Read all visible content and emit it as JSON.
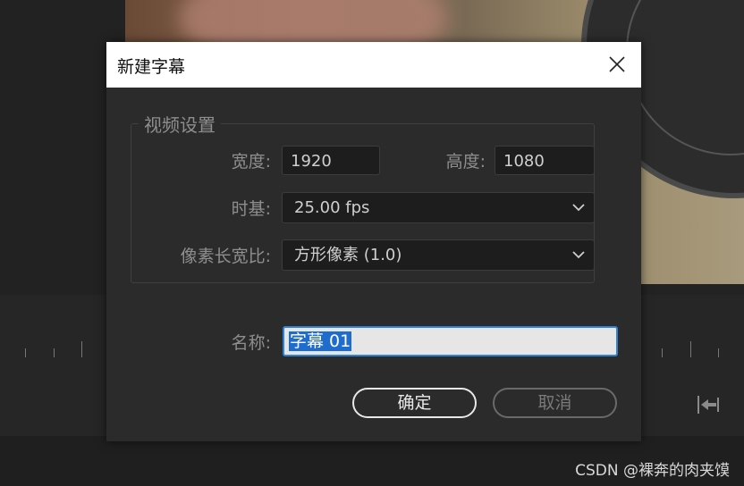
{
  "dialog": {
    "title": "新建字幕",
    "video_settings": {
      "legend": "视频设置",
      "width_label": "宽度:",
      "width_value": "1920",
      "height_label": "高度:",
      "height_value": "1080",
      "timebase_label": "时基:",
      "timebase_value": "25.00 fps",
      "aspect_label": "像素长宽比:",
      "aspect_value": "方形像素 (1.0)"
    },
    "name_label": "名称:",
    "name_value": "字幕 01",
    "ok_label": "确定",
    "cancel_label": "取消"
  },
  "watermark": "CSDN @裸奔的肉夹馍",
  "icons": [
    "close-icon",
    "chevron-down-icon",
    "go-to-out-point-icon"
  ],
  "colors": {
    "accent": "#2f82d6",
    "selection": "#1f6ccf",
    "dialog_bg": "#2b2b2b"
  }
}
